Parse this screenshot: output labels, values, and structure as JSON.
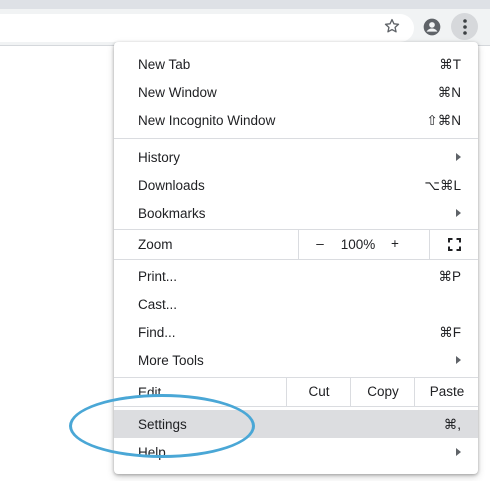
{
  "colors": {
    "accent_ring": "#4aa7d6",
    "toolbar_bg": "#f1f3f4",
    "hover_bg": "#dcdde0"
  },
  "toolbar": {
    "icons": [
      "star-icon",
      "profile-icon",
      "more-vert-icon"
    ]
  },
  "menu": {
    "new_tab": {
      "label": "New Tab",
      "shortcut": "⌘T"
    },
    "new_window": {
      "label": "New Window",
      "shortcut": "⌘N"
    },
    "new_incognito": {
      "label": "New Incognito Window",
      "shortcut": "⇧⌘N"
    },
    "history": {
      "label": "History"
    },
    "downloads": {
      "label": "Downloads",
      "shortcut": "⌥⌘L"
    },
    "bookmarks": {
      "label": "Bookmarks"
    },
    "zoom": {
      "label": "Zoom",
      "minus": "–",
      "value": "100%",
      "plus": "+"
    },
    "print": {
      "label": "Print...",
      "shortcut": "⌘P"
    },
    "cast": {
      "label": "Cast..."
    },
    "find": {
      "label": "Find...",
      "shortcut": "⌘F"
    },
    "more_tools": {
      "label": "More Tools"
    },
    "edit": {
      "label": "Edit",
      "cut": "Cut",
      "copy": "Copy",
      "paste": "Paste"
    },
    "settings": {
      "label": "Settings",
      "shortcut": "⌘,"
    },
    "help": {
      "label": "Help"
    }
  }
}
